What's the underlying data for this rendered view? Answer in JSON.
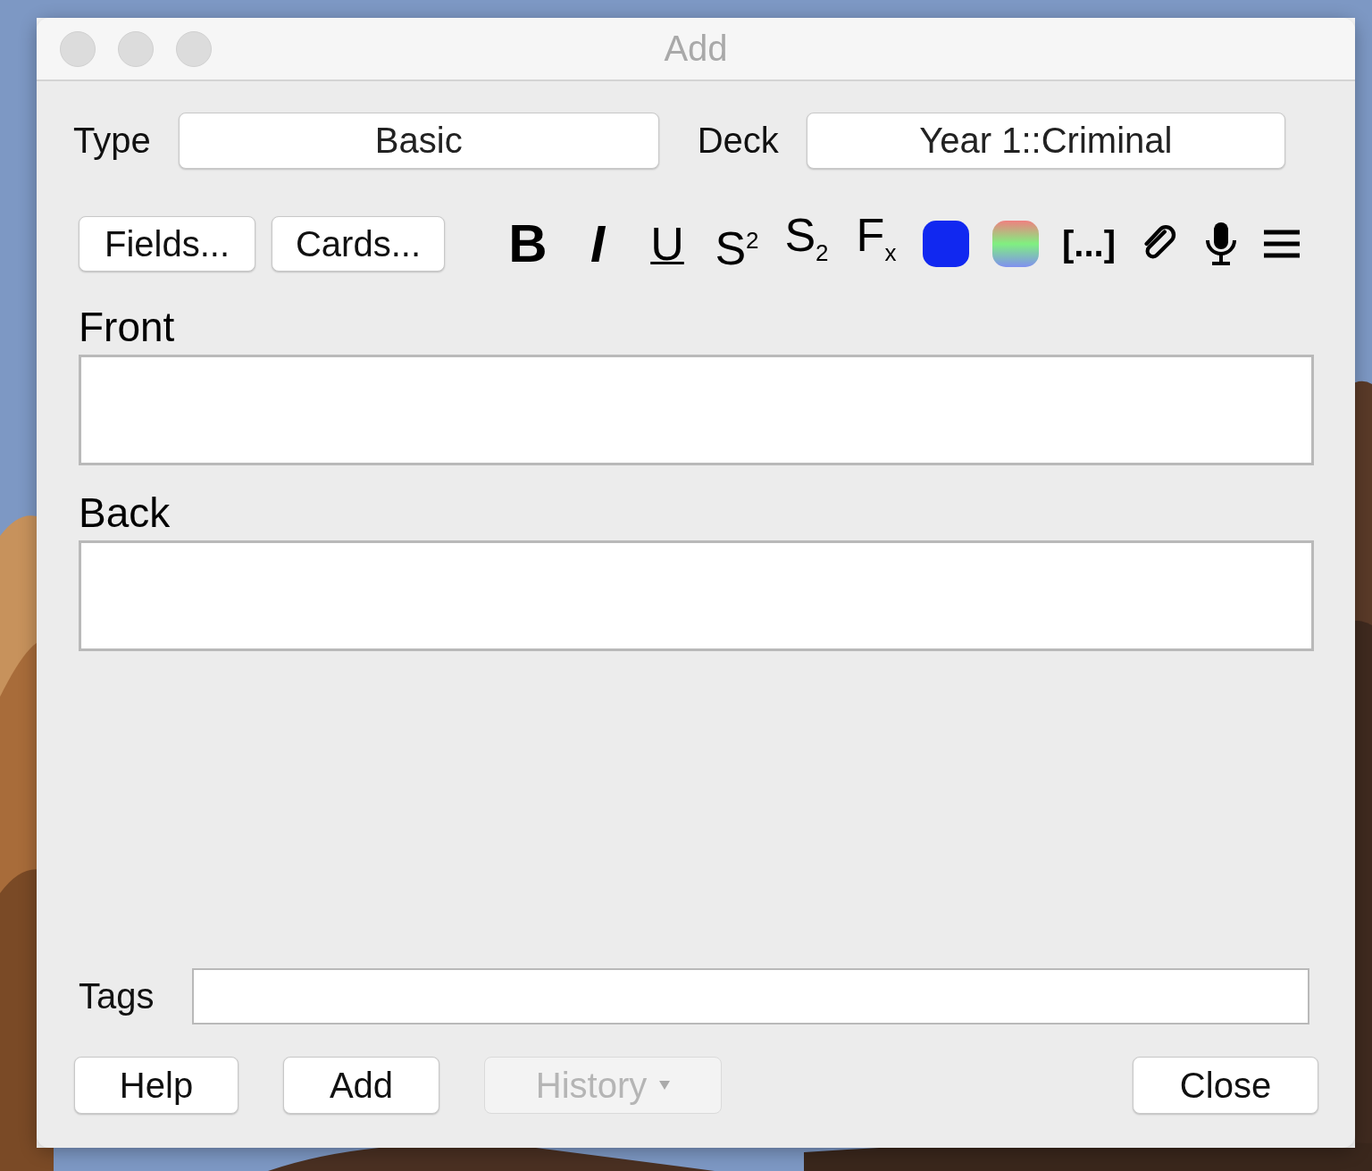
{
  "window": {
    "title": "Add"
  },
  "note_type": {
    "label": "Type",
    "value": "Basic"
  },
  "deck": {
    "label": "Deck",
    "value": "Year 1::Criminal"
  },
  "editor_buttons": [
    {
      "label": "Fields..."
    },
    {
      "label": "Cards..."
    }
  ],
  "toolbar": [
    {
      "kind": "bold",
      "label": "B"
    },
    {
      "kind": "italic",
      "label": "I"
    },
    {
      "kind": "underline",
      "label": "U"
    },
    {
      "kind": "superscript",
      "label": "S$^{2}$"
    },
    {
      "kind": "subscript",
      "label": "S$_{2}$"
    },
    {
      "kind": "clear",
      "label": "F$_{x}$"
    },
    {
      "kind": "swatch",
      "color": "#1128f0"
    },
    {
      "kind": "gradient"
    },
    {
      "kind": "cloze",
      "label": "[...]"
    },
    {
      "kind": "attach"
    },
    {
      "kind": "record"
    },
    {
      "kind": "menu"
    }
  ],
  "fields": [
    {
      "name": "Front"
    },
    {
      "name": "Back"
    }
  ],
  "tags": {
    "label": "Tags"
  },
  "buttons": [
    {
      "label": "Help",
      "disabled": false,
      "dropdown": false
    },
    {
      "label": "Add",
      "disabled": false,
      "dropdown": false
    },
    {
      "label": "History",
      "disabled": true,
      "dropdown": true
    },
    {
      "label": "Close",
      "disabled": false,
      "dropdown": false
    }
  ]
}
